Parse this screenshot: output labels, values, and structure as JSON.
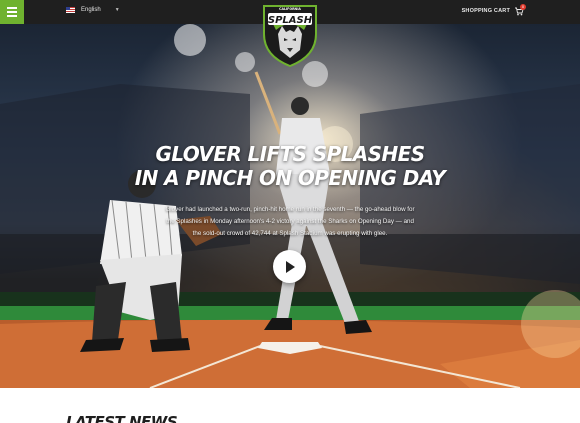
{
  "header": {
    "language": "English",
    "cart_label": "SHOPPING CART",
    "cart_count": "0",
    "logo_top_text": "CALIFORNIA",
    "logo_text": "SPLASH"
  },
  "hero": {
    "headline_line1": "GLOVER LIFTS SPLASHES",
    "headline_line2": "IN A PINCH ON OPENING DAY",
    "summary": "Glover had launched a two-run, pinch-hit home run in the seventh — the go-ahead blow for the Splashes in Monday afternoon's 4-2 victory against the Sharks on Opening Day — and the sold-out crowd of 42,744 at Splash Stadium was erupting with glee."
  },
  "sections": {
    "latest_news": "LATEST NEWS"
  },
  "colors": {
    "accent": "#6fb22f",
    "topbar": "#1f1f1f",
    "badge": "#e23b2e"
  },
  "icons": [
    "menu-icon",
    "us-flag-icon",
    "chevron-down-icon",
    "cart-icon",
    "play-icon"
  ]
}
